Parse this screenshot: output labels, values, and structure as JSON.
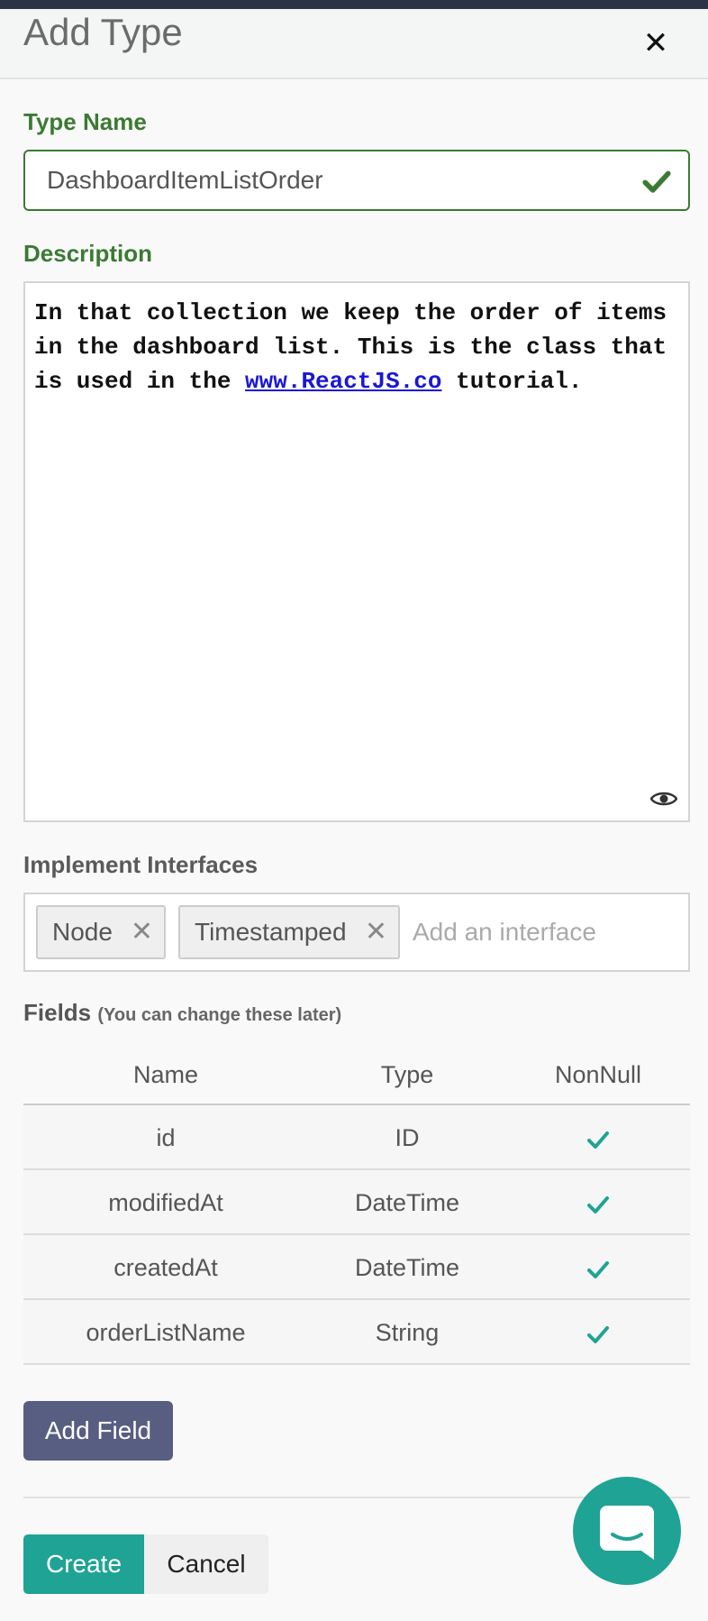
{
  "modal": {
    "title": "Add Type",
    "close_icon": "close-icon"
  },
  "type_name": {
    "label": "Type Name",
    "value": "DashboardItemListOrder"
  },
  "description": {
    "label": "Description",
    "text_before": "In that collection we keep the order of items in the dashboard list. This is the class that is used in the ",
    "link_text": "www.ReactJS.co",
    "text_after": " tutorial."
  },
  "interfaces": {
    "label": "Implement Interfaces",
    "tags": [
      "Node",
      "Timestamped"
    ],
    "tag_remove": "✕",
    "placeholder": "Add an interface"
  },
  "fields": {
    "title": "Fields",
    "subtitle": "(You can change these later)",
    "columns": [
      "Name",
      "Type",
      "NonNull"
    ],
    "rows": [
      {
        "name": "id",
        "type": "ID"
      },
      {
        "name": "modifiedAt",
        "type": "DateTime"
      },
      {
        "name": "createdAt",
        "type": "DateTime"
      },
      {
        "name": "orderListName",
        "type": "String"
      }
    ]
  },
  "buttons": {
    "add_field": "Add Field",
    "create": "Create",
    "cancel": "Cancel"
  },
  "colors": {
    "accent_green": "#3b7a33",
    "teal": "#1fa394",
    "purple": "#585d82"
  }
}
